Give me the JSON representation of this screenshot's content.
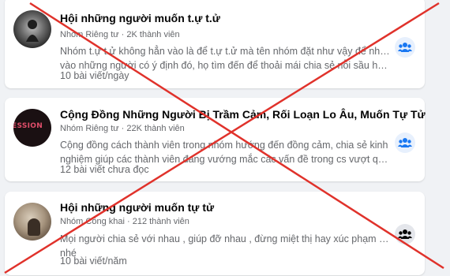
{
  "groups": [
    {
      "title": "Hội những người muốn t.ự t.ử",
      "meta": "Nhóm Riêng tư · 2K thành viên",
      "desc_line1": "Nhóm t.ự t.ử không hẳn vào là để t.ự t.ử mà tên nhóm đặt như vậy để nhắm",
      "desc_line2": "vào những người có ý định đó, họ tìm đến để thoải mái chia sẻ nỗi sầu hơi...",
      "stat": "10 bài viết/ngày",
      "avatar_icon": "person-silhouette",
      "join_icon": "group-icon"
    },
    {
      "title": "Cộng Đồng Những Người Bị Trầm Cảm, Rối Loạn Lo Âu, Muốn Tự Tử",
      "meta": "Nhóm Riêng tư · 22K thành viên",
      "desc_line1": "Cộng đồng cách thành viên trong nhóm hướng đến đồng cảm, chia sẻ kinh",
      "desc_line2": "nghiệm giúp các thành viên đang vướng mắc các vấn đề trong cs vượt qua k...",
      "stat": "12 bài viết chưa đọc",
      "avatar_text": "ESSION",
      "join_icon": "group-icon"
    },
    {
      "title": "Hội những người muốn tự tử",
      "meta": "Nhóm Công khai · 212 thành viên",
      "desc_line1": "Mọi người chia sẻ với nhau , giúp đỡ nhau , đừng miệt thị hay xúc phạm nỗi đau",
      "desc_line2": "nhé",
      "stat": "10 bài viết/năm",
      "avatar_icon": "person-silhouette",
      "join_icon": "group-icon"
    }
  ],
  "colors": {
    "background": "#f0f2f5",
    "card": "#ffffff",
    "title": "#050505",
    "secondary": "#65676b",
    "accent_blue": "#1877f2",
    "cross_red": "#e0322b"
  }
}
